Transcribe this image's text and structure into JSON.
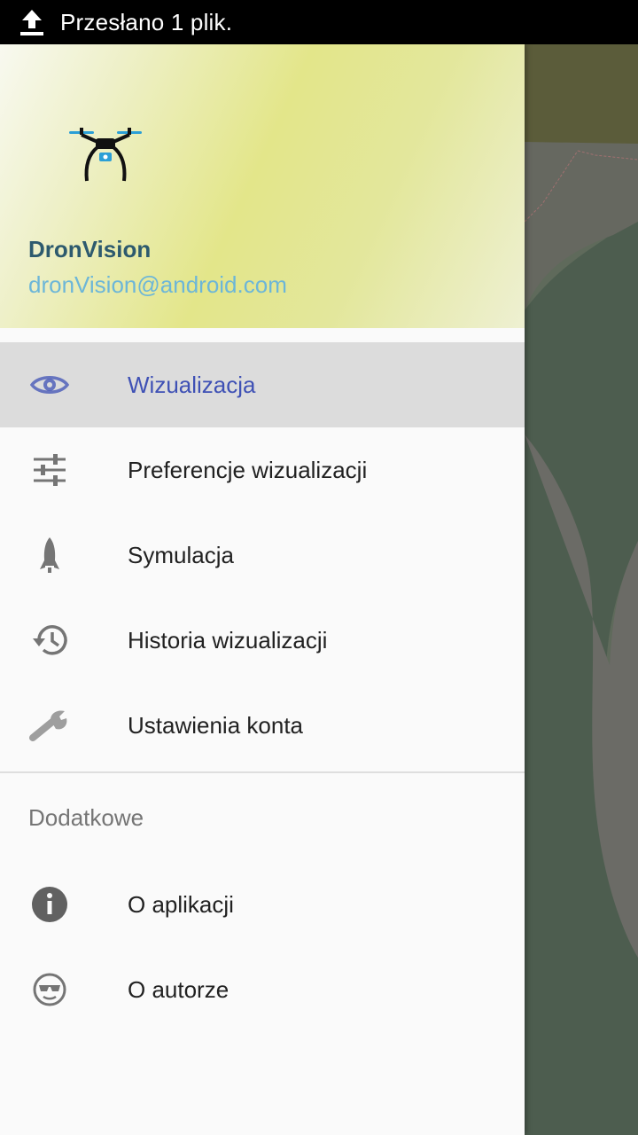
{
  "status_bar": {
    "text": "Przesłano 1 plik.",
    "icon": "upload-icon"
  },
  "header": {
    "app_name": "DronVision",
    "email": "dronVision@android.com",
    "logo": "drone-icon"
  },
  "menu": {
    "items": [
      {
        "label": "Wizualizacja",
        "icon": "eye-icon",
        "active": true
      },
      {
        "label": "Preferencje wizualizacji",
        "icon": "sliders-icon",
        "active": false
      },
      {
        "label": "Symulacja",
        "icon": "rocket-icon",
        "active": false
      },
      {
        "label": "Historia wizualizacji",
        "icon": "history-icon",
        "active": false
      },
      {
        "label": "Ustawienia konta",
        "icon": "wrench-icon",
        "active": false
      }
    ],
    "section_title": "Dodatkowe",
    "extra_items": [
      {
        "label": "O aplikacji",
        "icon": "info-icon"
      },
      {
        "label": "O autorze",
        "icon": "sunglasses-face-icon"
      }
    ]
  },
  "colors": {
    "accent": "#3f51b5",
    "header_name": "#2d5a6e",
    "header_email": "#6cb6d8",
    "active_bg": "#dcdcdc"
  }
}
